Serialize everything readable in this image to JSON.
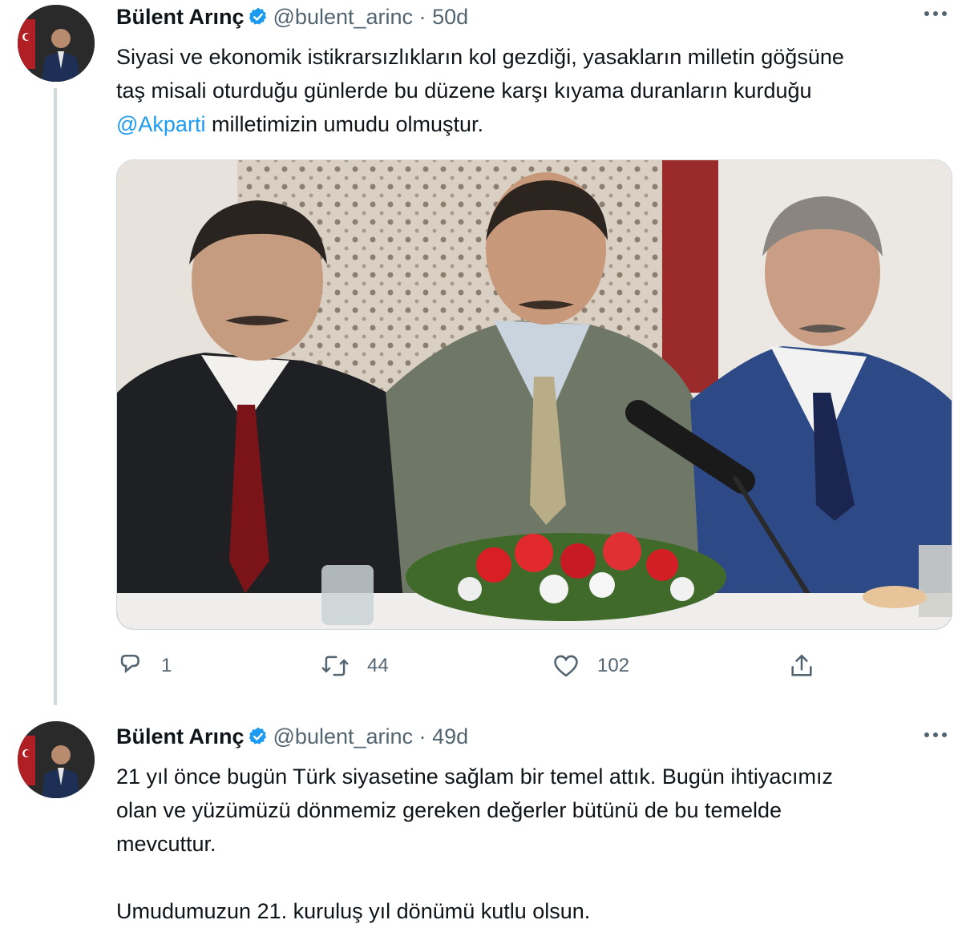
{
  "tweets": [
    {
      "name": "Bülent Arınç",
      "handle": "@bulent_arinc",
      "separator": "·",
      "time": "50d",
      "text_lines": [
        "Siyasi ve ekonomik istikrarsızlıkların kol gezdiği, yasakların milletin göğsüne",
        "taş misali oturduğu günlerde bu düzene karşı kıyama duranların kurduğu"
      ],
      "mention": "@Akparti",
      "text_tail": " milletimizin umudu olmuştur.",
      "actions": {
        "reply_count": "1",
        "retweet_count": "44",
        "like_count": "102"
      }
    },
    {
      "name": "Bülent Arınç",
      "handle": "@bulent_arinc",
      "separator": "·",
      "time": "49d",
      "text_lines": [
        "21 yıl önce bugün Türk siyasetine sağlam bir temel attık. Bugün ihtiyacımız",
        "olan ve yüzümüzü dönmemiz gereken değerler bütünü de bu temelde",
        "mevcuttur."
      ],
      "text_paragraph2": "Umudumuzun 21. kuruluş yıl dönümü kutlu olsun."
    }
  ],
  "icons": {
    "verified": "verified-badge-icon",
    "more": "more-horizontal-icon",
    "reply": "reply-icon",
    "retweet": "retweet-icon",
    "like": "heart-icon",
    "share": "share-icon"
  },
  "colors": {
    "link": "#1d9bf0",
    "secondary_text": "#536471",
    "verified": "#1d9bf0",
    "thread_line": "#cfd9de"
  }
}
